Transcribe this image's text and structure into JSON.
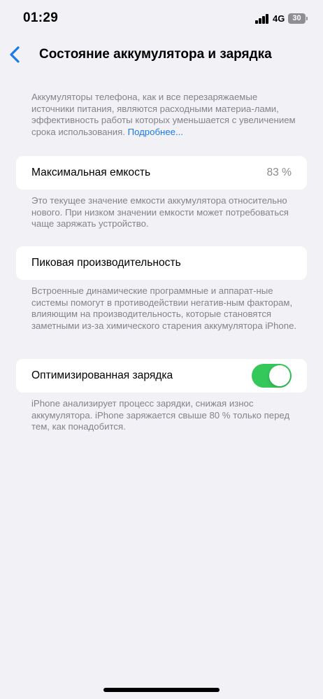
{
  "status_bar": {
    "time": "01:29",
    "network": "4G",
    "battery": "30"
  },
  "nav": {
    "title": "Состояние аккумулятора и зарядка"
  },
  "intro": {
    "text": "Аккумуляторы телефона, как и все перезаряжаемые источники питания, являются расходными материа-лами, эффективность работы которых уменьшается с увеличением срока использования.",
    "link": "Подробнее..."
  },
  "max_capacity": {
    "label": "Максимальная емкость",
    "value": "83 %",
    "description": "Это текущее значение емкости аккумулятора относительно нового. При низком значении емкости может потребоваться чаще заряжать устройство."
  },
  "peak_performance": {
    "label": "Пиковая производительность",
    "description": "Встроенные динамические программные и аппарат-ные системы помогут в противодействии негатив-ным факторам, влияющим на производительность, которые становятся заметными из-за химического старения аккумулятора iPhone."
  },
  "optimized_charging": {
    "label": "Оптимизированная зарядка",
    "enabled": true,
    "description": "iPhone анализирует процесс зарядки, снижая износ аккумулятора. iPhone заряжается свыше 80 % только перед тем, как понадобится."
  },
  "colors": {
    "accent": "#1a7ae8",
    "toggle_on": "#34c759",
    "background": "#f2f1f6"
  }
}
